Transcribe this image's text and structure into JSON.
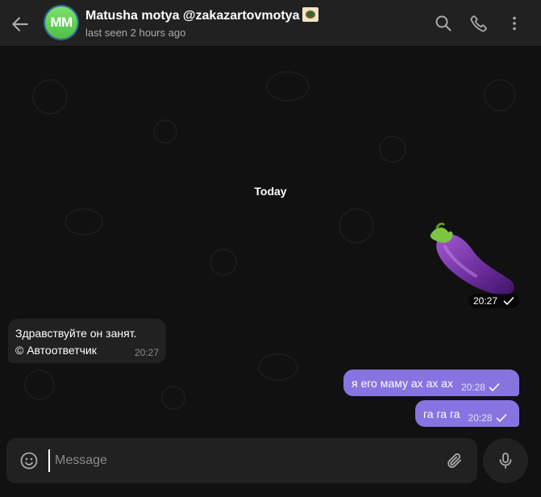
{
  "header": {
    "back_icon": "arrow-left-icon",
    "avatar_initials": "MM",
    "title": "Matusha motya @zakazartovmotya",
    "status": "last seen 2 hours ago",
    "actions": [
      "search-icon",
      "phone-icon",
      "more-vertical-icon"
    ]
  },
  "chat": {
    "date_label": "Today",
    "messages": [
      {
        "direction": "outgoing",
        "type": "sticker",
        "sticker": "eggplant",
        "time": "20:27",
        "status": "sent"
      },
      {
        "direction": "incoming",
        "type": "text",
        "lines": [
          "Здравствуйте он занят.",
          "© Автоответчик"
        ],
        "time": "20:27"
      },
      {
        "direction": "outgoing",
        "type": "text",
        "text": "я его маму ах ах ах",
        "time": "20:28",
        "status": "sent"
      },
      {
        "direction": "outgoing",
        "type": "text",
        "text": "га га га",
        "time": "20:28",
        "status": "sent"
      }
    ]
  },
  "composer": {
    "placeholder": "Message",
    "value": "",
    "emoji_icon": "smile-icon",
    "attach_icon": "paperclip-icon",
    "mic_icon": "microphone-icon"
  },
  "colors": {
    "background": "#111112",
    "panel": "#212121",
    "outgoing_bubble": "#8774e1",
    "incoming_bubble": "#212121",
    "avatar": "#5ccf4e",
    "muted_text": "#aaaaaa"
  }
}
